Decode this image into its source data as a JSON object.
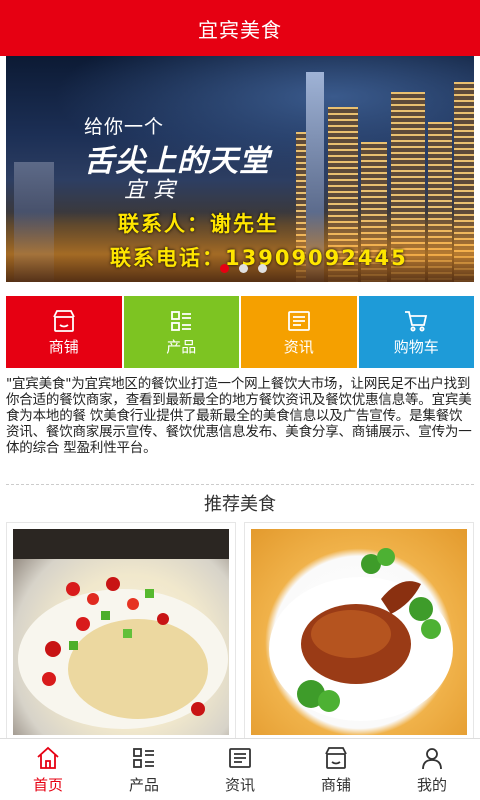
{
  "header": {
    "title": "宜宾美食"
  },
  "banner": {
    "small_text": "给你一个",
    "main_text": "舌尖上的天堂",
    "city": "宜 宾",
    "contact": "联系人：谢先生",
    "phone": "联系电话：13909092445",
    "slides_count": 3,
    "active_slide": 1
  },
  "categories": [
    {
      "label": "商铺",
      "icon": "shop-icon",
      "color": "#e60012"
    },
    {
      "label": "产品",
      "icon": "product-grid-icon",
      "color": "#7dc422"
    },
    {
      "label": "资讯",
      "icon": "news-icon",
      "color": "#f5a000"
    },
    {
      "label": "购物车",
      "icon": "cart-icon",
      "color": "#1e9bd8"
    }
  ],
  "intro": "\"宜宾美食\"为宜宾地区的餐饮业打造一个网上餐饮大市场，让网民足不出户找到你合适的餐饮商家，查看到最新最全的地方餐饮资讯及餐饮优惠信息等。宜宾美食为本地的餐 饮美食行业提供了最新最全的美食信息以及广告宣传。是集餐饮资讯、餐饮商家展示宣传、餐饮优惠信息发布、美食分享、商铺展示、宣传为一体的综合 型盈利性平台。",
  "section": {
    "title": "推荐美食"
  },
  "foods": [
    {
      "name": "chicken-dish"
    },
    {
      "name": "roast-duck-dish"
    }
  ],
  "tabbar": [
    {
      "label": "首页",
      "icon": "home-icon",
      "active": true
    },
    {
      "label": "产品",
      "icon": "product-list-icon",
      "active": false
    },
    {
      "label": "资讯",
      "icon": "news-icon",
      "active": false
    },
    {
      "label": "商铺",
      "icon": "shop-icon",
      "active": false
    },
    {
      "label": "我的",
      "icon": "user-icon",
      "active": false
    }
  ],
  "colors": {
    "brand": "#e60012",
    "tab_active": "#e60012"
  }
}
